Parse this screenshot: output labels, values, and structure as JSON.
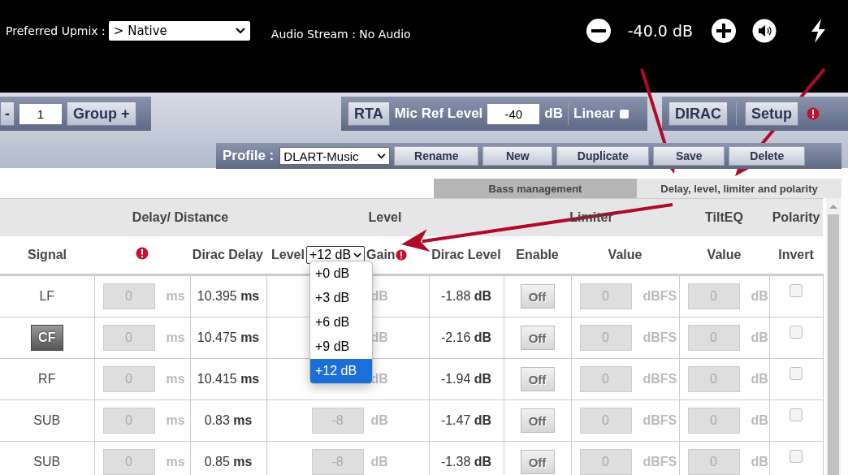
{
  "top_bar": {
    "upmix_label": "Preferred Upmix :",
    "upmix_value": "> Native",
    "audio_stream": "Audio Stream : No Audio",
    "volume": "-40.0 dB"
  },
  "toolbar": {
    "minus_label": "-",
    "group_number": "1",
    "group_plus": "Group +",
    "rta": "RTA",
    "mic_ref_label": "Mic Ref Level",
    "mic_ref_value": "-40",
    "mic_ref_unit": "dB",
    "linear_label": "Linear",
    "linear_checked": false,
    "dirac": "DIRAC",
    "setup": "Setup"
  },
  "profile": {
    "label": "Profile :",
    "value": "DLART-Music",
    "buttons": [
      "Rename",
      "New",
      "Duplicate",
      "Save",
      "Delete"
    ]
  },
  "tabs": [
    {
      "label": "Bass management",
      "selected": false
    },
    {
      "label": "Delay, level, limiter and polarity",
      "selected": true
    }
  ],
  "table": {
    "groups": [
      "Delay/ Distance",
      "Level",
      "Limiter",
      "TiltEQ",
      "Polarity"
    ],
    "columns": {
      "signal": "Signal",
      "dirac_delay": "Dirac Delay",
      "level": "Level",
      "level_select": "+12 dB",
      "gain": "Gain",
      "dirac_level": "Dirac Level",
      "enable": "Enable",
      "limiter_value": "Value",
      "tilt_value": "Value",
      "invert": "Invert"
    },
    "rows": [
      {
        "signal": "LF",
        "kind": "text",
        "delay": "0",
        "delay_unit": "ms",
        "dirac_delay": "10.395",
        "dirac_delay_unit": "ms",
        "level_unit": "dB",
        "dirac_level": "-1.88",
        "dirac_level_unit": "dB",
        "enable": "Off",
        "limiter": "0",
        "limiter_unit": "dBFS",
        "tilt": "0",
        "tilt_unit": "dB",
        "invert": false
      },
      {
        "signal": "CF",
        "kind": "button",
        "delay": "0",
        "delay_unit": "ms",
        "dirac_delay": "10.475",
        "dirac_delay_unit": "ms",
        "level_unit": "dB",
        "dirac_level": "-2.16",
        "dirac_level_unit": "dB",
        "enable": "Off",
        "limiter": "0",
        "limiter_unit": "dBFS",
        "tilt": "0",
        "tilt_unit": "dB",
        "invert": false
      },
      {
        "signal": "RF",
        "kind": "text",
        "delay": "0",
        "delay_unit": "ms",
        "dirac_delay": "10.415",
        "dirac_delay_unit": "ms",
        "level_unit": "dB",
        "dirac_level": "-1.94",
        "dirac_level_unit": "dB",
        "enable": "Off",
        "limiter": "0",
        "limiter_unit": "dBFS",
        "tilt": "0",
        "tilt_unit": "dB",
        "invert": false
      },
      {
        "signal": "SUB",
        "kind": "text",
        "delay": "0",
        "delay_unit": "ms",
        "dirac_delay": "0.83",
        "dirac_delay_unit": "ms",
        "level": "-8",
        "level_unit": "dB",
        "dirac_level": "-1.47",
        "dirac_level_unit": "dB",
        "enable": "Off",
        "limiter": "0",
        "limiter_unit": "dBFS",
        "tilt": "0",
        "tilt_unit": "dB",
        "invert": false
      },
      {
        "signal": "SUB",
        "kind": "text",
        "delay": "0",
        "delay_unit": "ms",
        "dirac_delay": "0.85",
        "dirac_delay_unit": "ms",
        "level": "-8",
        "level_unit": "dB",
        "dirac_level": "-1.38",
        "dirac_level_unit": "dB",
        "enable": "Off",
        "limiter": "0",
        "limiter_unit": "dBFS",
        "tilt": "0",
        "tilt_unit": "dB",
        "invert": false
      }
    ]
  },
  "dropdown": {
    "options": [
      {
        "label": "+0 dB",
        "selected": false
      },
      {
        "label": "+3 dB",
        "selected": false
      },
      {
        "label": "+6 dB",
        "selected": false
      },
      {
        "label": "+9 dB",
        "selected": false
      },
      {
        "label": "+12 dB",
        "selected": true
      }
    ]
  }
}
